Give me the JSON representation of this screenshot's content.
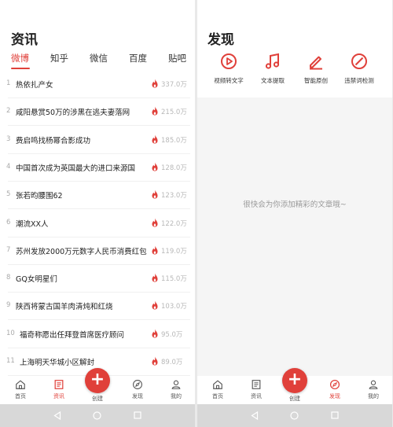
{
  "news": {
    "title": "资讯",
    "tabs": [
      "微博",
      "知乎",
      "微信",
      "百度",
      "贴吧"
    ],
    "active_tab": "微博",
    "items": [
      {
        "rank": "1",
        "text": "热依扎产女",
        "hot": "337.0万"
      },
      {
        "rank": "2",
        "text": "咸阳悬赏50万的涉黑在逃夫妻落网",
        "hot": "215.0万"
      },
      {
        "rank": "3",
        "text": "费启鸣找杨幂合影成功",
        "hot": "185.0万"
      },
      {
        "rank": "4",
        "text": "中国首次成为英国最大的进口来源国",
        "hot": "128.0万"
      },
      {
        "rank": "5",
        "text": "张若昀腰围62",
        "hot": "123.0万"
      },
      {
        "rank": "6",
        "text": "潮流XX人",
        "hot": "122.0万"
      },
      {
        "rank": "7",
        "text": "苏州发放2000万元数字人民币消费红包",
        "hot": "119.0万"
      },
      {
        "rank": "8",
        "text": "GQ女明星们",
        "hot": "115.0万"
      },
      {
        "rank": "9",
        "text": "陕西将蒙古国羊肉清炖和红烧",
        "hot": "103.0万"
      },
      {
        "rank": "10",
        "text": "福奇称愿出任拜登首席医疗顾问",
        "hot": "95.0万"
      },
      {
        "rank": "11",
        "text": "上海明天华城小区解封",
        "hot": "89.0万"
      }
    ]
  },
  "discover": {
    "title": "发现",
    "tools": [
      "视频转文字",
      "文本提取",
      "智能原创",
      "违禁词检测"
    ],
    "empty_text": "很快会为你添加精彩的文章哦~"
  },
  "nav": {
    "home": "首页",
    "news": "资讯",
    "create": "创建",
    "discover": "发现",
    "mine": "我的",
    "fab_symbol": "+"
  },
  "colors": {
    "accent": "#e0403a"
  }
}
